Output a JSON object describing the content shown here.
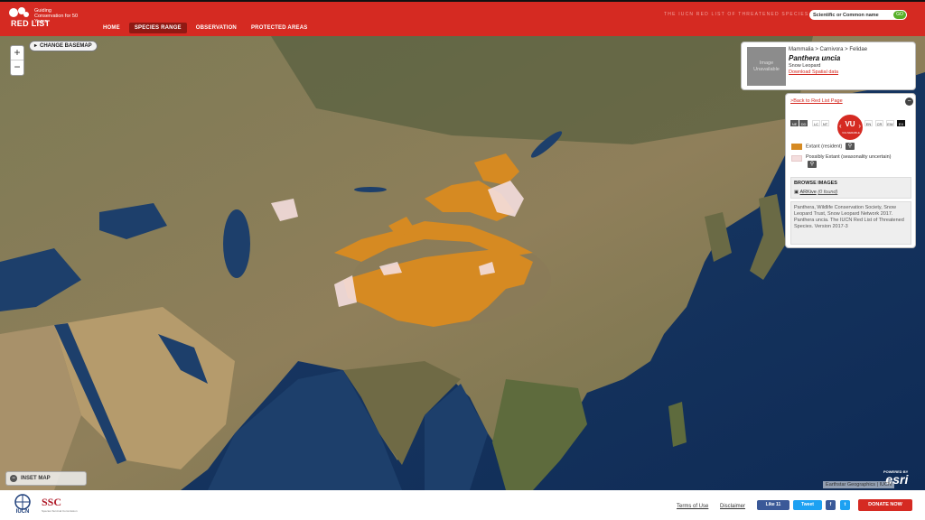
{
  "header": {
    "logo_text": "RED LIST",
    "tagline": "Guiding Conservation for 50 Years",
    "site_title": "THE IUCN RED LIST OF THREATENED SPECIES",
    "nav": [
      "HOME",
      "SPECIES RANGE",
      "OBSERVATION",
      "PROTECTED AREAS"
    ],
    "active_nav": "SPECIES RANGE",
    "search_placeholder": "Scientific or Common name",
    "search_go": "GO"
  },
  "map_controls": {
    "zoom_in": "+",
    "zoom_out": "−",
    "basemap_label": "CHANGE BASEMAP",
    "inset_label": "INSET MAP",
    "attribution": "Earthstar Geographics | IUCN",
    "esri_powered": "POWERED BY",
    "esri_brand": "esri"
  },
  "species": {
    "image_placeholder": "Image Unavailable",
    "taxonomy": "Mammalia > Carnivora > Felidae",
    "scientific_name": "Panthera uncia",
    "common_name": "Snow Leopard",
    "download_label": "Download Spatial data"
  },
  "info_panel": {
    "back_link": ">Back to Red List Page",
    "categories": [
      "NE",
      "DD",
      "LC",
      "NT",
      "VU",
      "EN",
      "CR",
      "EW",
      "EX"
    ],
    "selected_category": "VU",
    "selected_category_full": "VULNERABLE",
    "legend": [
      {
        "label": "Extant (resident)",
        "color": "#d68a22"
      },
      {
        "label": "Possibly Extant (seasonality uncertain)",
        "color": "#f4dede"
      }
    ],
    "browse_title": "BROWSE IMAGES",
    "browse_source": "ARKive",
    "browse_count": "(0 found)",
    "citation": "Panthera, Wildlife Conservation Society, Snow Leopard Trust, Snow Leopard Network 2017. Panthera uncia. The IUCN Red List of Threatened Species. Version 2017-3"
  },
  "footer": {
    "iucn": "IUCN",
    "ssc": "SSC",
    "ssc_sub": "Species Survival Commission",
    "terms": "Terms of Use",
    "disclaimer": "Disclaimer",
    "facebook": "Like 11",
    "twitter": "Tweet",
    "donate": "DONATE NOW"
  },
  "colors": {
    "brand_red": "#d52a22",
    "range_extant": "#d68a22",
    "range_possibly": "#f4dede"
  }
}
